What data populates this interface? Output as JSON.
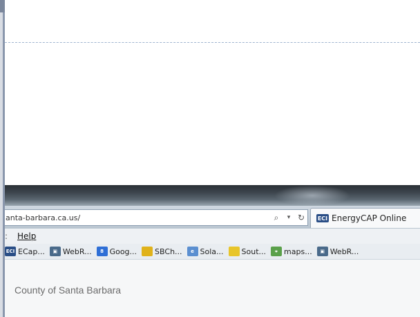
{
  "browser": {
    "url": "anta-barbara.ca.us/",
    "search_icon": "search-icon",
    "refresh_icon": "refresh-icon",
    "tab": {
      "icon": "ECI",
      "label": "EnergyCAP Online"
    }
  },
  "menu": {
    "items": [
      "Help"
    ]
  },
  "favorites": [
    {
      "label": "ECap...",
      "icon": "ECI",
      "color": "#2a4e86"
    },
    {
      "label": "WebR...",
      "icon": "page-icon",
      "color": "#4a6a8a"
    },
    {
      "label": "Goog...",
      "icon": "google-icon",
      "color": "#2f6fd6"
    },
    {
      "label": "SBCh...",
      "icon": "folder-icon",
      "color": "#e0b21a"
    },
    {
      "label": "Sola...",
      "icon": "ie-icon",
      "color": "#5b8fd0"
    },
    {
      "label": "Sout...",
      "icon": "note-icon",
      "color": "#e8c52a"
    },
    {
      "label": "maps...",
      "icon": "maps-icon",
      "color": "#5aa04a"
    },
    {
      "label": "WebR...",
      "icon": "page-icon",
      "color": "#4a6a8a"
    }
  ],
  "page": {
    "title": "County of Santa Barbara"
  }
}
